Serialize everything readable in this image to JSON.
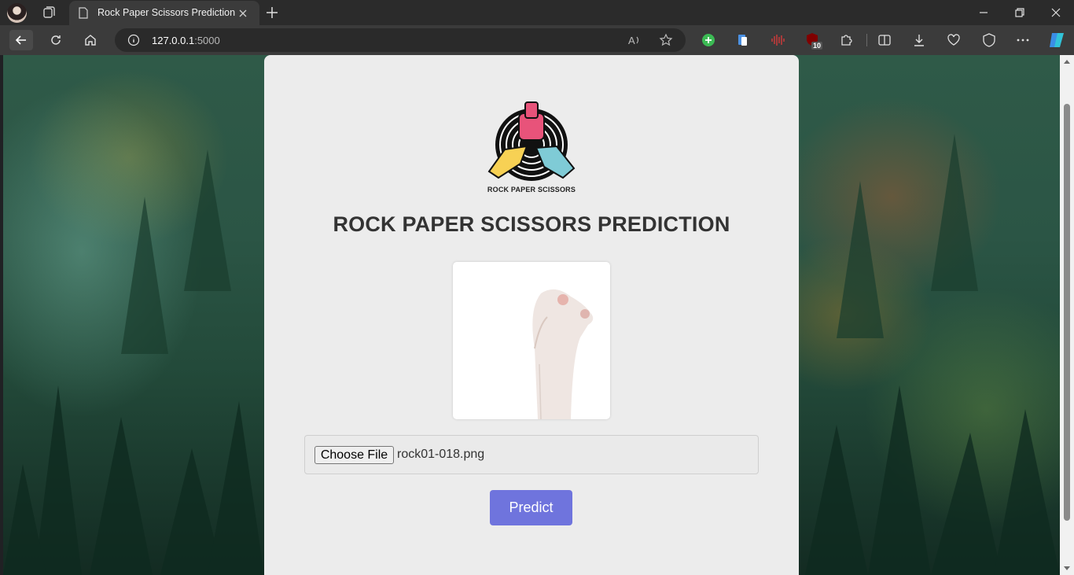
{
  "browser": {
    "tab_title": "Rock Paper Scissors Prediction",
    "url_host": "127.0.0.1",
    "url_port": ":5000",
    "extension_badge": "10"
  },
  "page": {
    "logo_text": "ROCK PAPER SCISSORS",
    "heading": "ROCK PAPER SCISSORS PREDICTION",
    "choose_file_label": "Choose File",
    "selected_file": "rock01-018.png",
    "predict_label": "Predict"
  },
  "colors": {
    "predict_button": "#6f74dd",
    "card_background": "#ececec"
  }
}
